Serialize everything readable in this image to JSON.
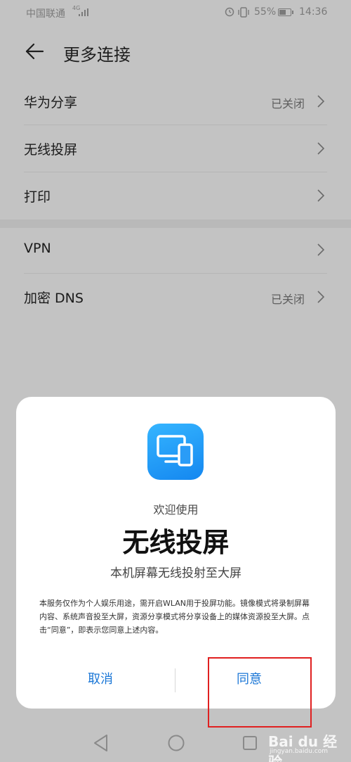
{
  "status_bar": {
    "carrier": "中国联通",
    "network": "4G",
    "battery": "55%",
    "time": "14:36"
  },
  "header": {
    "title": "更多连接"
  },
  "settings": {
    "group1": [
      {
        "label": "华为分享",
        "value": "已关闭"
      },
      {
        "label": "无线投屏",
        "value": ""
      },
      {
        "label": "打印",
        "value": ""
      }
    ],
    "group2": [
      {
        "label": "VPN",
        "value": ""
      },
      {
        "label": "加密 DNS",
        "value": "已关闭"
      }
    ]
  },
  "dialog": {
    "welcome": "欢迎使用",
    "title": "无线投屏",
    "subtitle": "本机屏幕无线投射至大屏",
    "body": "本服务仅作为个人娱乐用途，需开启WLAN用于投屏功能。镜像模式将录制屏幕内容、系统声音投至大屏，资源分享模式将分享设备上的媒体资源投至大屏。点击“同意”，即表示您同意上述内容。",
    "cancel_label": "取消",
    "agree_label": "同意",
    "app_icon": "screen-cast-icon"
  },
  "watermark": {
    "text": "Bai du 经验",
    "sub": "jingyan.baidu.com"
  },
  "colors": {
    "accent": "#1a76d6",
    "highlight": "#e02020",
    "dim_background": "#c3c3c3"
  }
}
